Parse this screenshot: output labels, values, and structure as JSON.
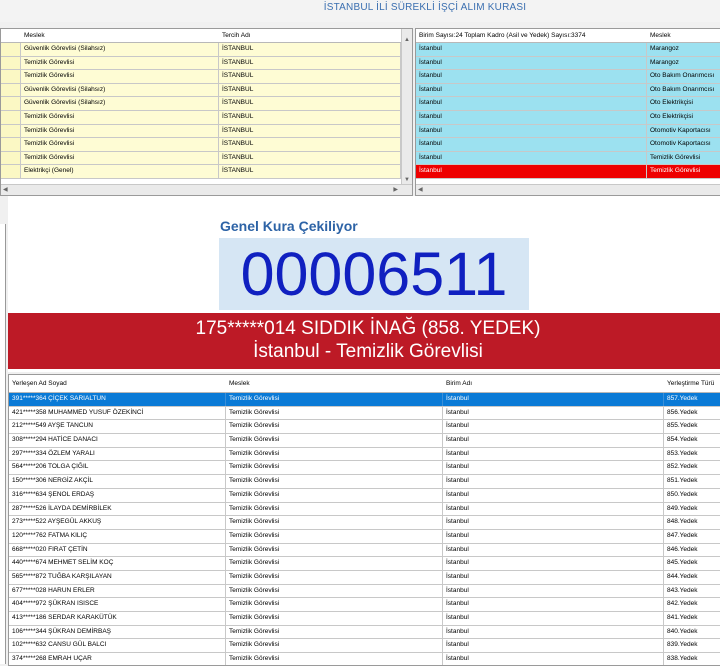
{
  "app_title": "İSTANBUL İLİ SÜREKLİ İŞÇİ ALIM KURASI",
  "top_left": {
    "columns": [
      "",
      "Meslek",
      "Tercih Adı"
    ],
    "rows": [
      [
        "Güvenlik Görevlisi (Silahsız)",
        "İSTANBUL"
      ],
      [
        "Temizlik Görevlisi",
        "İSTANBUL"
      ],
      [
        "Temizlik Görevlisi",
        "İSTANBUL"
      ],
      [
        "Güvenlik Görevlisi (Silahsız)",
        "İSTANBUL"
      ],
      [
        "Güvenlik Görevlisi (Silahsız)",
        "İSTANBUL"
      ],
      [
        "Temizlik Görevlisi",
        "İSTANBUL"
      ],
      [
        "Temizlik Görevlisi",
        "İSTANBUL"
      ],
      [
        "Temizlik Görevlisi",
        "İSTANBUL"
      ],
      [
        "Temizlik Görevlisi",
        "İSTANBUL"
      ],
      [
        "Elektrikçi (Genel)",
        "İSTANBUL"
      ]
    ]
  },
  "top_right": {
    "columns": [
      "Birim Sayısı:24 Toplam Kadro (Asil ve Yedek) Sayısı:3374",
      "Meslek"
    ],
    "rows": [
      [
        "İstanbul",
        "Marangoz"
      ],
      [
        "İstanbul",
        "Marangoz"
      ],
      [
        "İstanbul",
        "Oto Bakım Onarımcısı"
      ],
      [
        "İstanbul",
        "Oto Bakım Onarımcısı"
      ],
      [
        "İstanbul",
        "Oto Elektrikçisi"
      ],
      [
        "İstanbul",
        "Oto Elektrikçisi"
      ],
      [
        "İstanbul",
        "Otomotiv Kaportacısı"
      ],
      [
        "İstanbul",
        "Otomotiv Kaportacısı"
      ],
      [
        "İstanbul",
        "Temizlik Görevlisi"
      ],
      [
        "İstanbul",
        "Temizlik Görevlisi"
      ]
    ],
    "selected_index": 9
  },
  "draw": {
    "label": "Genel Kura Çekiliyor",
    "number": "00006511",
    "winner_line1": "175*****014 SIDDIK İNAĞ (858. YEDEK)",
    "winner_line2": "İstanbul - Temizlik Görevlisi"
  },
  "bottom": {
    "columns": [
      "Yerleşen Ad Soyad",
      "Meslek",
      "Birim Adı",
      "Yerleştirme Türü"
    ],
    "rows": [
      [
        "391*****364 ÇİÇEK SARIALTUN",
        "Temizlik Görevlisi",
        "İstanbul",
        "857.Yedek"
      ],
      [
        "421*****358 MUHAMMED YUSUF ÖZEKİNCİ",
        "Temizlik Görevlisi",
        "İstanbul",
        "856.Yedek"
      ],
      [
        "212*****549 AYŞE TANCUN",
        "Temizlik Görevlisi",
        "İstanbul",
        "855.Yedek"
      ],
      [
        "308*****294 HATİCE DANACI",
        "Temizlik Görevlisi",
        "İstanbul",
        "854.Yedek"
      ],
      [
        "297*****334 ÖZLEM YARALI",
        "Temizlik Görevlisi",
        "İstanbul",
        "853.Yedek"
      ],
      [
        "564*****206 TOLGA ÇIĞIL",
        "Temizlik Görevlisi",
        "İstanbul",
        "852.Yedek"
      ],
      [
        "150*****306 NERGİZ AKÇİL",
        "Temizlik Görevlisi",
        "İstanbul",
        "851.Yedek"
      ],
      [
        "316*****634 ŞENOL ERDAŞ",
        "Temizlik Görevlisi",
        "İstanbul",
        "850.Yedek"
      ],
      [
        "287*****526 İLAYDA DEMİRBİLEK",
        "Temizlik Görevlisi",
        "İstanbul",
        "849.Yedek"
      ],
      [
        "273*****522 AYŞEGÜL AKKUŞ",
        "Temizlik Görevlisi",
        "İstanbul",
        "848.Yedek"
      ],
      [
        "120*****762 FATMA KILIÇ",
        "Temizlik Görevlisi",
        "İstanbul",
        "847.Yedek"
      ],
      [
        "668*****020 FIRAT ÇETİN",
        "Temizlik Görevlisi",
        "İstanbul",
        "846.Yedek"
      ],
      [
        "440*****674 MEHMET SELİM KOÇ",
        "Temizlik Görevlisi",
        "İstanbul",
        "845.Yedek"
      ],
      [
        "565*****872 TUĞBA KARŞILAYAN",
        "Temizlik Görevlisi",
        "İstanbul",
        "844.Yedek"
      ],
      [
        "677*****028 HARUN ERLER",
        "Temizlik Görevlisi",
        "İstanbul",
        "843.Yedek"
      ],
      [
        "404*****972 ŞÜKRAN ISISCE",
        "Temizlik Görevlisi",
        "İstanbul",
        "842.Yedek"
      ],
      [
        "413*****186 SERDAR KARAKÜTÜK",
        "Temizlik Görevlisi",
        "İstanbul",
        "841.Yedek"
      ],
      [
        "106*****344 ŞÜKRAN DEMİRBAŞ",
        "Temizlik Görevlisi",
        "İstanbul",
        "840.Yedek"
      ],
      [
        "102*****632 CANSU GÜL BALCI",
        "Temizlik Görevlisi",
        "İstanbul",
        "839.Yedek"
      ],
      [
        "374*****268 EMRAH UÇAR",
        "Temizlik Görevlisi",
        "İstanbul",
        "838.Yedek"
      ]
    ],
    "selected_index": 0
  }
}
